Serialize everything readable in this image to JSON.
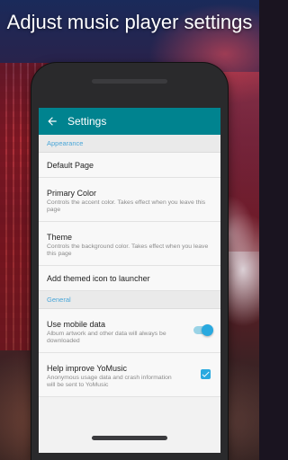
{
  "headline": "Adjust music player settings",
  "appbar": {
    "title": "Settings",
    "back_icon": "arrow-back-icon"
  },
  "sections": [
    {
      "header": "Appearance",
      "items": [
        {
          "title": "Default Page",
          "summary": ""
        },
        {
          "title": "Primary Color",
          "summary": "Controls the accent color. Takes effect when you leave this page"
        },
        {
          "title": "Theme",
          "summary": "Controls the background color. Takes effect when you leave this page"
        },
        {
          "title": "Add themed icon to launcher",
          "summary": ""
        }
      ]
    },
    {
      "header": "General",
      "items": [
        {
          "title": "Use mobile data",
          "summary": "Album artwork and other data will always be downloaded",
          "control": "switch",
          "on": true
        },
        {
          "title": "Help improve YoMusic",
          "summary": "Anonymous usage data and crash information will be sent to YoMusic",
          "control": "checkbox",
          "checked": true
        }
      ]
    }
  ],
  "colors": {
    "appbar": "#00838f",
    "accent": "#29a9df",
    "section_header_text": "#4aa6d8"
  }
}
